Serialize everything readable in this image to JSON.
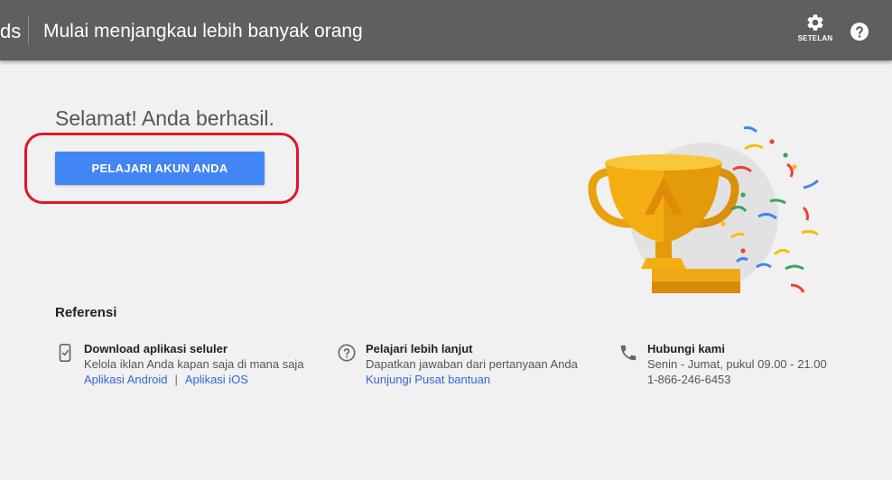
{
  "header": {
    "brand_tail": "ds",
    "title": "Mulai menjangkau lebih banyak orang",
    "settings_label": "SETELAN"
  },
  "main": {
    "headline": "Selamat! Anda berhasil.",
    "cta_label": "PELAJARI AKUN ANDA",
    "highlight_color": "#e0152a",
    "accent_color": "#4285f4"
  },
  "references": {
    "heading": "Referensi",
    "items": [
      {
        "icon": "mobile-phone-icon",
        "title": "Download aplikasi seluler",
        "description": "Kelola iklan Anda kapan saja di mana saja",
        "links": [
          "Aplikasi Android",
          "Aplikasi iOS"
        ],
        "separator": "|"
      },
      {
        "icon": "help-circle-icon",
        "title": "Pelajari lebih lanjut",
        "description": "Dapatkan jawaban dari pertanyaan Anda",
        "links": [
          "Kunjungi Pusat bantuan"
        ]
      },
      {
        "icon": "phone-icon",
        "title": "Hubungi kami",
        "description": "Senin - Jumat, pukul 09.00 - 21.00",
        "phone": "1-866-246-6453"
      }
    ]
  }
}
